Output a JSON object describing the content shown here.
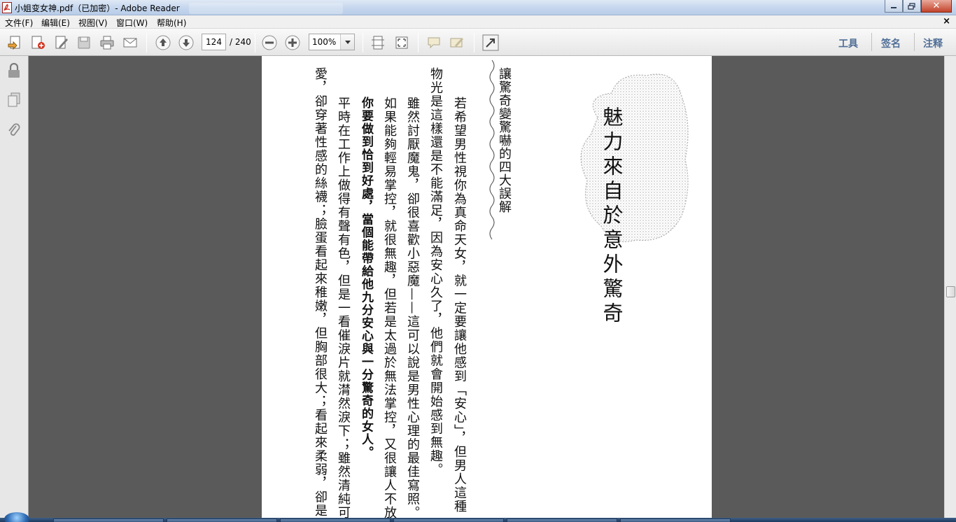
{
  "window": {
    "title": "小姐变女神.pdf（已加密）- Adobe Reader",
    "close_symbol": "✕"
  },
  "menubar": {
    "items": [
      "文件(F)",
      "编辑(E)",
      "视图(V)",
      "窗口(W)",
      "帮助(H)"
    ],
    "close_symbol": "×"
  },
  "toolbar": {
    "page_current": "124",
    "page_total": "/ 240",
    "zoom": "100%",
    "right_tools": [
      "工具",
      "签名",
      "注释"
    ]
  },
  "document": {
    "heading": "魅力來自於意外驚奇",
    "subheading": "讓驚奇變驚嚇的四大誤解",
    "paragraphs": [
      "若希望男性視你為真命天女，就一定要讓他感到「安心」，但男人這種",
      "物光是這樣還是不能滿足，因為安心久了，他們就會開始感到無趣。",
      "雖然討厭魔鬼，卻很喜歡小惡魔——這可以說是男性心理的最佳寫照。",
      "如果能夠輕易掌控，就很無趣，但若是太過於無法掌控，又很讓人不放心。",
      "你要做到恰到好處，當個能帶給他九分安心與一分驚奇的女人。",
      "平時在工作上做得有聲有色，但是一看催淚片就潸然淚下；雖然清純可",
      "愛，卻穿著性感的絲襪；臉蛋看起來稚嫩，但胸部很大；看起來柔弱，卻是"
    ]
  }
}
